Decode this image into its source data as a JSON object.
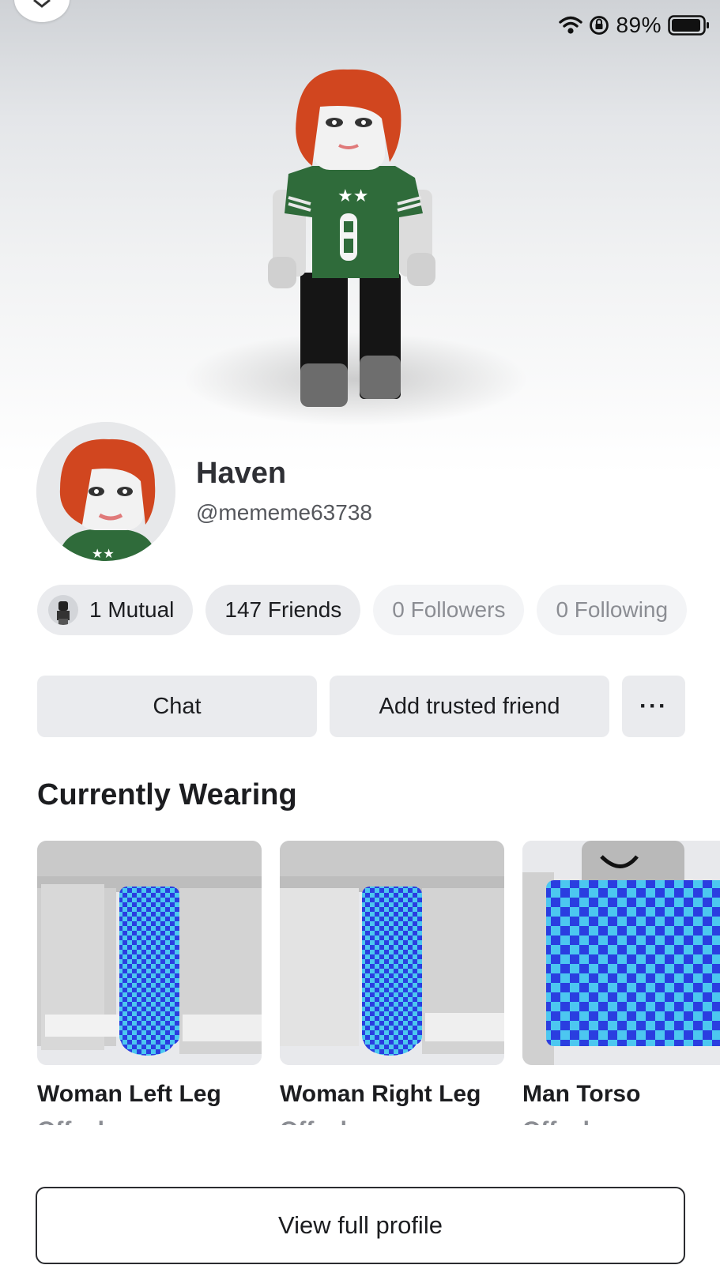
{
  "status_bar": {
    "battery_percent": "89%"
  },
  "profile": {
    "display_name": "Haven",
    "username": "@mememe63738"
  },
  "stats": {
    "mutual": "1 Mutual",
    "friends": "147 Friends",
    "followers": "0 Followers",
    "following": "0 Following"
  },
  "actions": {
    "chat": "Chat",
    "add_trusted_friend": "Add trusted friend",
    "more": "···"
  },
  "currently_wearing": {
    "title": "Currently Wearing",
    "items": [
      {
        "name": "Woman Left Leg",
        "status": "Offsale"
      },
      {
        "name": "Woman Right Leg",
        "status": "Offsale"
      },
      {
        "name": "Man Torso",
        "status": "Offsale"
      }
    ]
  },
  "footer": {
    "view_full_profile": "View full profile"
  },
  "icons": [
    "close-icon",
    "wifi-icon",
    "rotation-lock-icon",
    "battery-icon",
    "more-icon"
  ],
  "colors": {
    "chip_bg": "#eaebee",
    "muted_text": "#8b8d93",
    "accent_dark": "#1c1d20"
  }
}
